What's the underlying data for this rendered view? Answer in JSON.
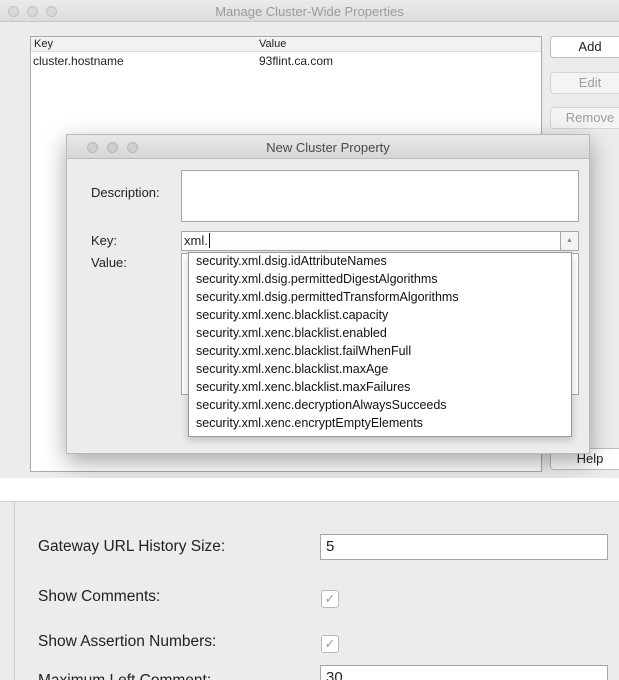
{
  "window": {
    "title": "Manage Cluster-Wide Properties"
  },
  "table": {
    "columns": [
      "Key",
      "Value"
    ],
    "rows": [
      {
        "key": "cluster.hostname",
        "value": "93flint.ca.com"
      }
    ]
  },
  "buttons": {
    "add": "Add",
    "edit": "Edit",
    "remove": "Remove",
    "help": "Help"
  },
  "dialog": {
    "title": "New Cluster Property",
    "description_label": "Description:",
    "description_value": "",
    "key_label": "Key:",
    "key_value": "xml.",
    "value_label": "Value:",
    "suggestions": [
      "security.xml.dsig.idAttributeNames",
      "security.xml.dsig.permittedDigestAlgorithms",
      "security.xml.dsig.permittedTransformAlgorithms",
      "security.xml.xenc.blacklist.capacity",
      "security.xml.xenc.blacklist.enabled",
      "security.xml.xenc.blacklist.failWhenFull",
      "security.xml.xenc.blacklist.maxAge",
      "security.xml.xenc.blacklist.maxFailures",
      "security.xml.xenc.decryptionAlwaysSucceeds",
      "security.xml.xenc.encryptEmptyElements"
    ]
  },
  "preferences": {
    "gateway_url_history_label": "Gateway URL History Size:",
    "gateway_url_history_value": "5",
    "show_comments_label": "Show Comments:",
    "show_comments_checked": true,
    "show_assertion_numbers_label": "Show Assertion Numbers:",
    "show_assertion_numbers_checked": true,
    "max_left_comment_label": "Maximum Left Comment:",
    "max_left_comment_value": "30"
  },
  "icons": {
    "close": "traffic-light-close-icon",
    "minimize": "traffic-light-minimize-icon",
    "zoom": "traffic-light-zoom-icon",
    "checkmark": "checkmark-icon",
    "dropdown": "combo-arrow-icon"
  }
}
